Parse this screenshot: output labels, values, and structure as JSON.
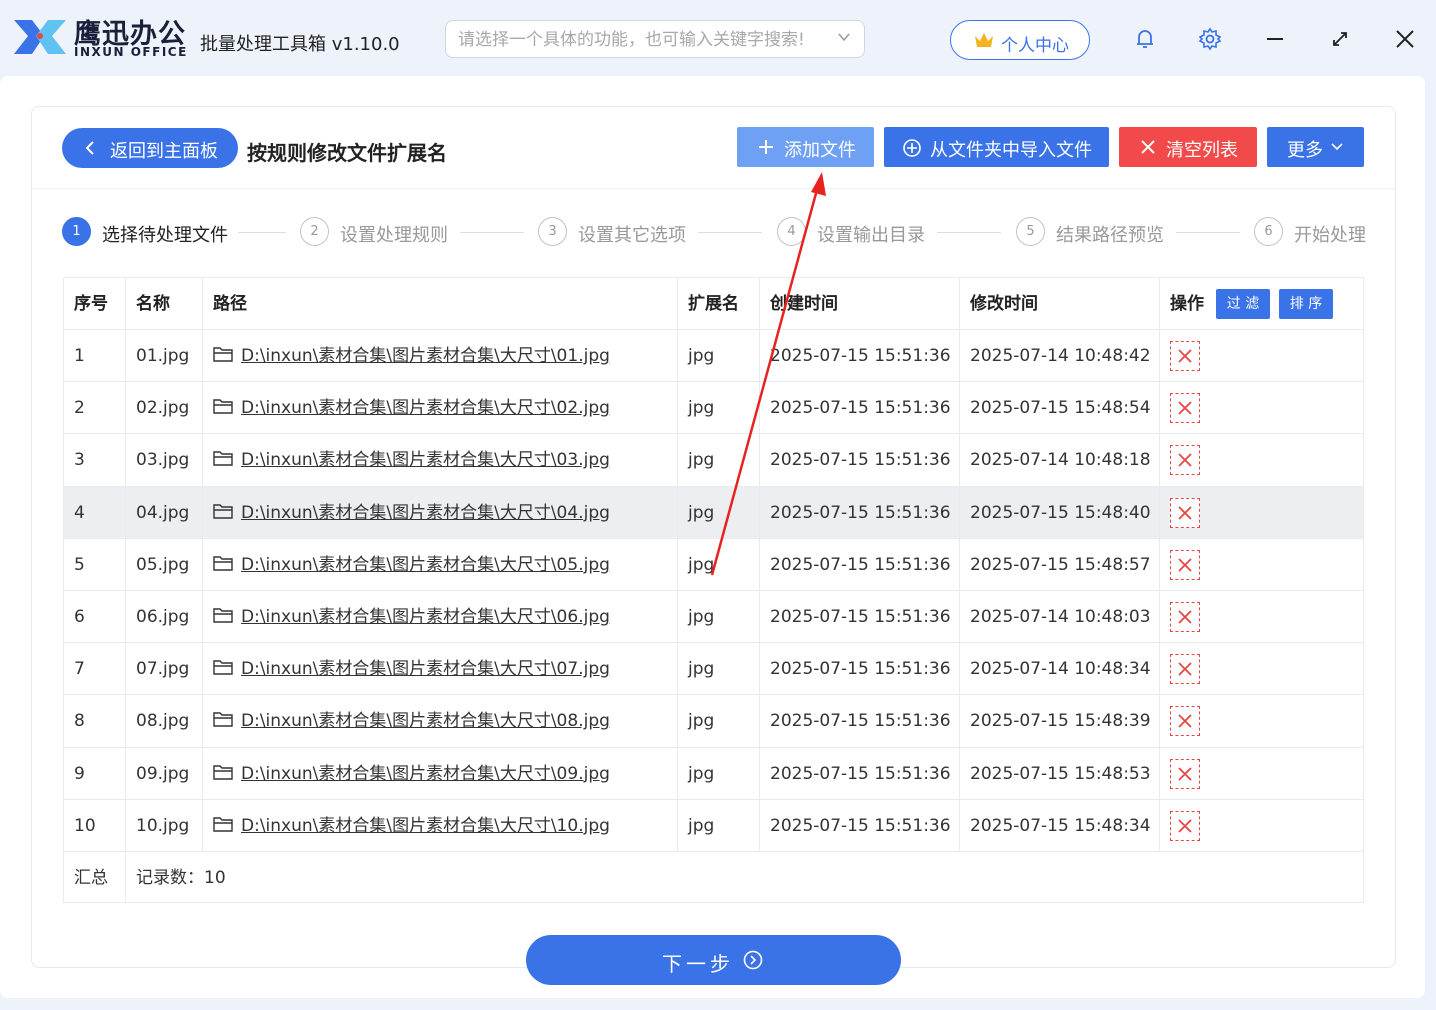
{
  "app": {
    "brand_cn": "鹰迅办公",
    "brand_en": "INXUN OFFICE",
    "title": "批量处理工具箱 v1.10.0"
  },
  "search": {
    "placeholder": "请选择一个具体的功能，也可输入关键字搜索!"
  },
  "personal_center": "个人中心",
  "header": {
    "back_label": "返回到主面板",
    "page_title": "按规则修改文件扩展名",
    "add_file": "添加文件",
    "import_folder": "从文件夹中导入文件",
    "clear_list": "清空列表",
    "more": "更多"
  },
  "steps": [
    {
      "num": "1",
      "label": "选择待处理文件"
    },
    {
      "num": "2",
      "label": "设置处理规则"
    },
    {
      "num": "3",
      "label": "设置其它选项"
    },
    {
      "num": "4",
      "label": "设置输出目录"
    },
    {
      "num": "5",
      "label": "结果路径预览"
    },
    {
      "num": "6",
      "label": "开始处理"
    }
  ],
  "table": {
    "columns": [
      "序号",
      "名称",
      "路径",
      "扩展名",
      "创建时间",
      "修改时间",
      "操作"
    ],
    "filter_label": "过 滤",
    "sort_label": "排 序",
    "rows": [
      {
        "no": "1",
        "name": "01.jpg",
        "path": "D:\\inxun\\素材合集\\图片素材合集\\大尺寸\\01.jpg",
        "ext": "jpg",
        "created": "2025-07-15 15:51:36",
        "modified": "2025-07-14 10:48:42"
      },
      {
        "no": "2",
        "name": "02.jpg",
        "path": "D:\\inxun\\素材合集\\图片素材合集\\大尺寸\\02.jpg",
        "ext": "jpg",
        "created": "2025-07-15 15:51:36",
        "modified": "2025-07-15 15:48:54"
      },
      {
        "no": "3",
        "name": "03.jpg",
        "path": "D:\\inxun\\素材合集\\图片素材合集\\大尺寸\\03.jpg",
        "ext": "jpg",
        "created": "2025-07-15 15:51:36",
        "modified": "2025-07-14 10:48:18"
      },
      {
        "no": "4",
        "name": "04.jpg",
        "path": "D:\\inxun\\素材合集\\图片素材合集\\大尺寸\\04.jpg",
        "ext": "jpg",
        "created": "2025-07-15 15:51:36",
        "modified": "2025-07-15 15:48:40"
      },
      {
        "no": "5",
        "name": "05.jpg",
        "path": "D:\\inxun\\素材合集\\图片素材合集\\大尺寸\\05.jpg",
        "ext": "jpg",
        "created": "2025-07-15 15:51:36",
        "modified": "2025-07-15 15:48:57"
      },
      {
        "no": "6",
        "name": "06.jpg",
        "path": "D:\\inxun\\素材合集\\图片素材合集\\大尺寸\\06.jpg",
        "ext": "jpg",
        "created": "2025-07-15 15:51:36",
        "modified": "2025-07-14 10:48:03"
      },
      {
        "no": "7",
        "name": "07.jpg",
        "path": "D:\\inxun\\素材合集\\图片素材合集\\大尺寸\\07.jpg",
        "ext": "jpg",
        "created": "2025-07-15 15:51:36",
        "modified": "2025-07-14 10:48:34"
      },
      {
        "no": "8",
        "name": "08.jpg",
        "path": "D:\\inxun\\素材合集\\图片素材合集\\大尺寸\\08.jpg",
        "ext": "jpg",
        "created": "2025-07-15 15:51:36",
        "modified": "2025-07-15 15:48:39"
      },
      {
        "no": "9",
        "name": "09.jpg",
        "path": "D:\\inxun\\素材合集\\图片素材合集\\大尺寸\\09.jpg",
        "ext": "jpg",
        "created": "2025-07-15 15:51:36",
        "modified": "2025-07-15 15:48:53"
      },
      {
        "no": "10",
        "name": "10.jpg",
        "path": "D:\\inxun\\素材合集\\图片素材合集\\大尺寸\\10.jpg",
        "ext": "jpg",
        "created": "2025-07-15 15:51:36",
        "modified": "2025-07-15 15:48:34"
      }
    ],
    "highlighted_row": 4,
    "summary_label": "汇总",
    "summary_count": "记录数：10"
  },
  "next_label": "下一步",
  "colors": {
    "primary": "#3a72e8",
    "add_file_bg": "#6ea1f3",
    "clear_bg": "#f24a4a",
    "delete_red": "#e84545",
    "annotation_arrow": "#e8231f"
  },
  "icons": {
    "back": "chevron-left-icon",
    "add": "plus-icon",
    "import": "plus-circle-icon",
    "clear": "close-icon",
    "more": "chevron-down-icon",
    "folder": "folder-icon",
    "delete": "close-icon",
    "bell": "bell-icon",
    "settings": "gear-icon",
    "minimize": "minimize-icon",
    "maximize": "maximize-icon",
    "close": "close-icon",
    "crown": "crown-icon",
    "next": "arrow-right-circle-icon"
  }
}
